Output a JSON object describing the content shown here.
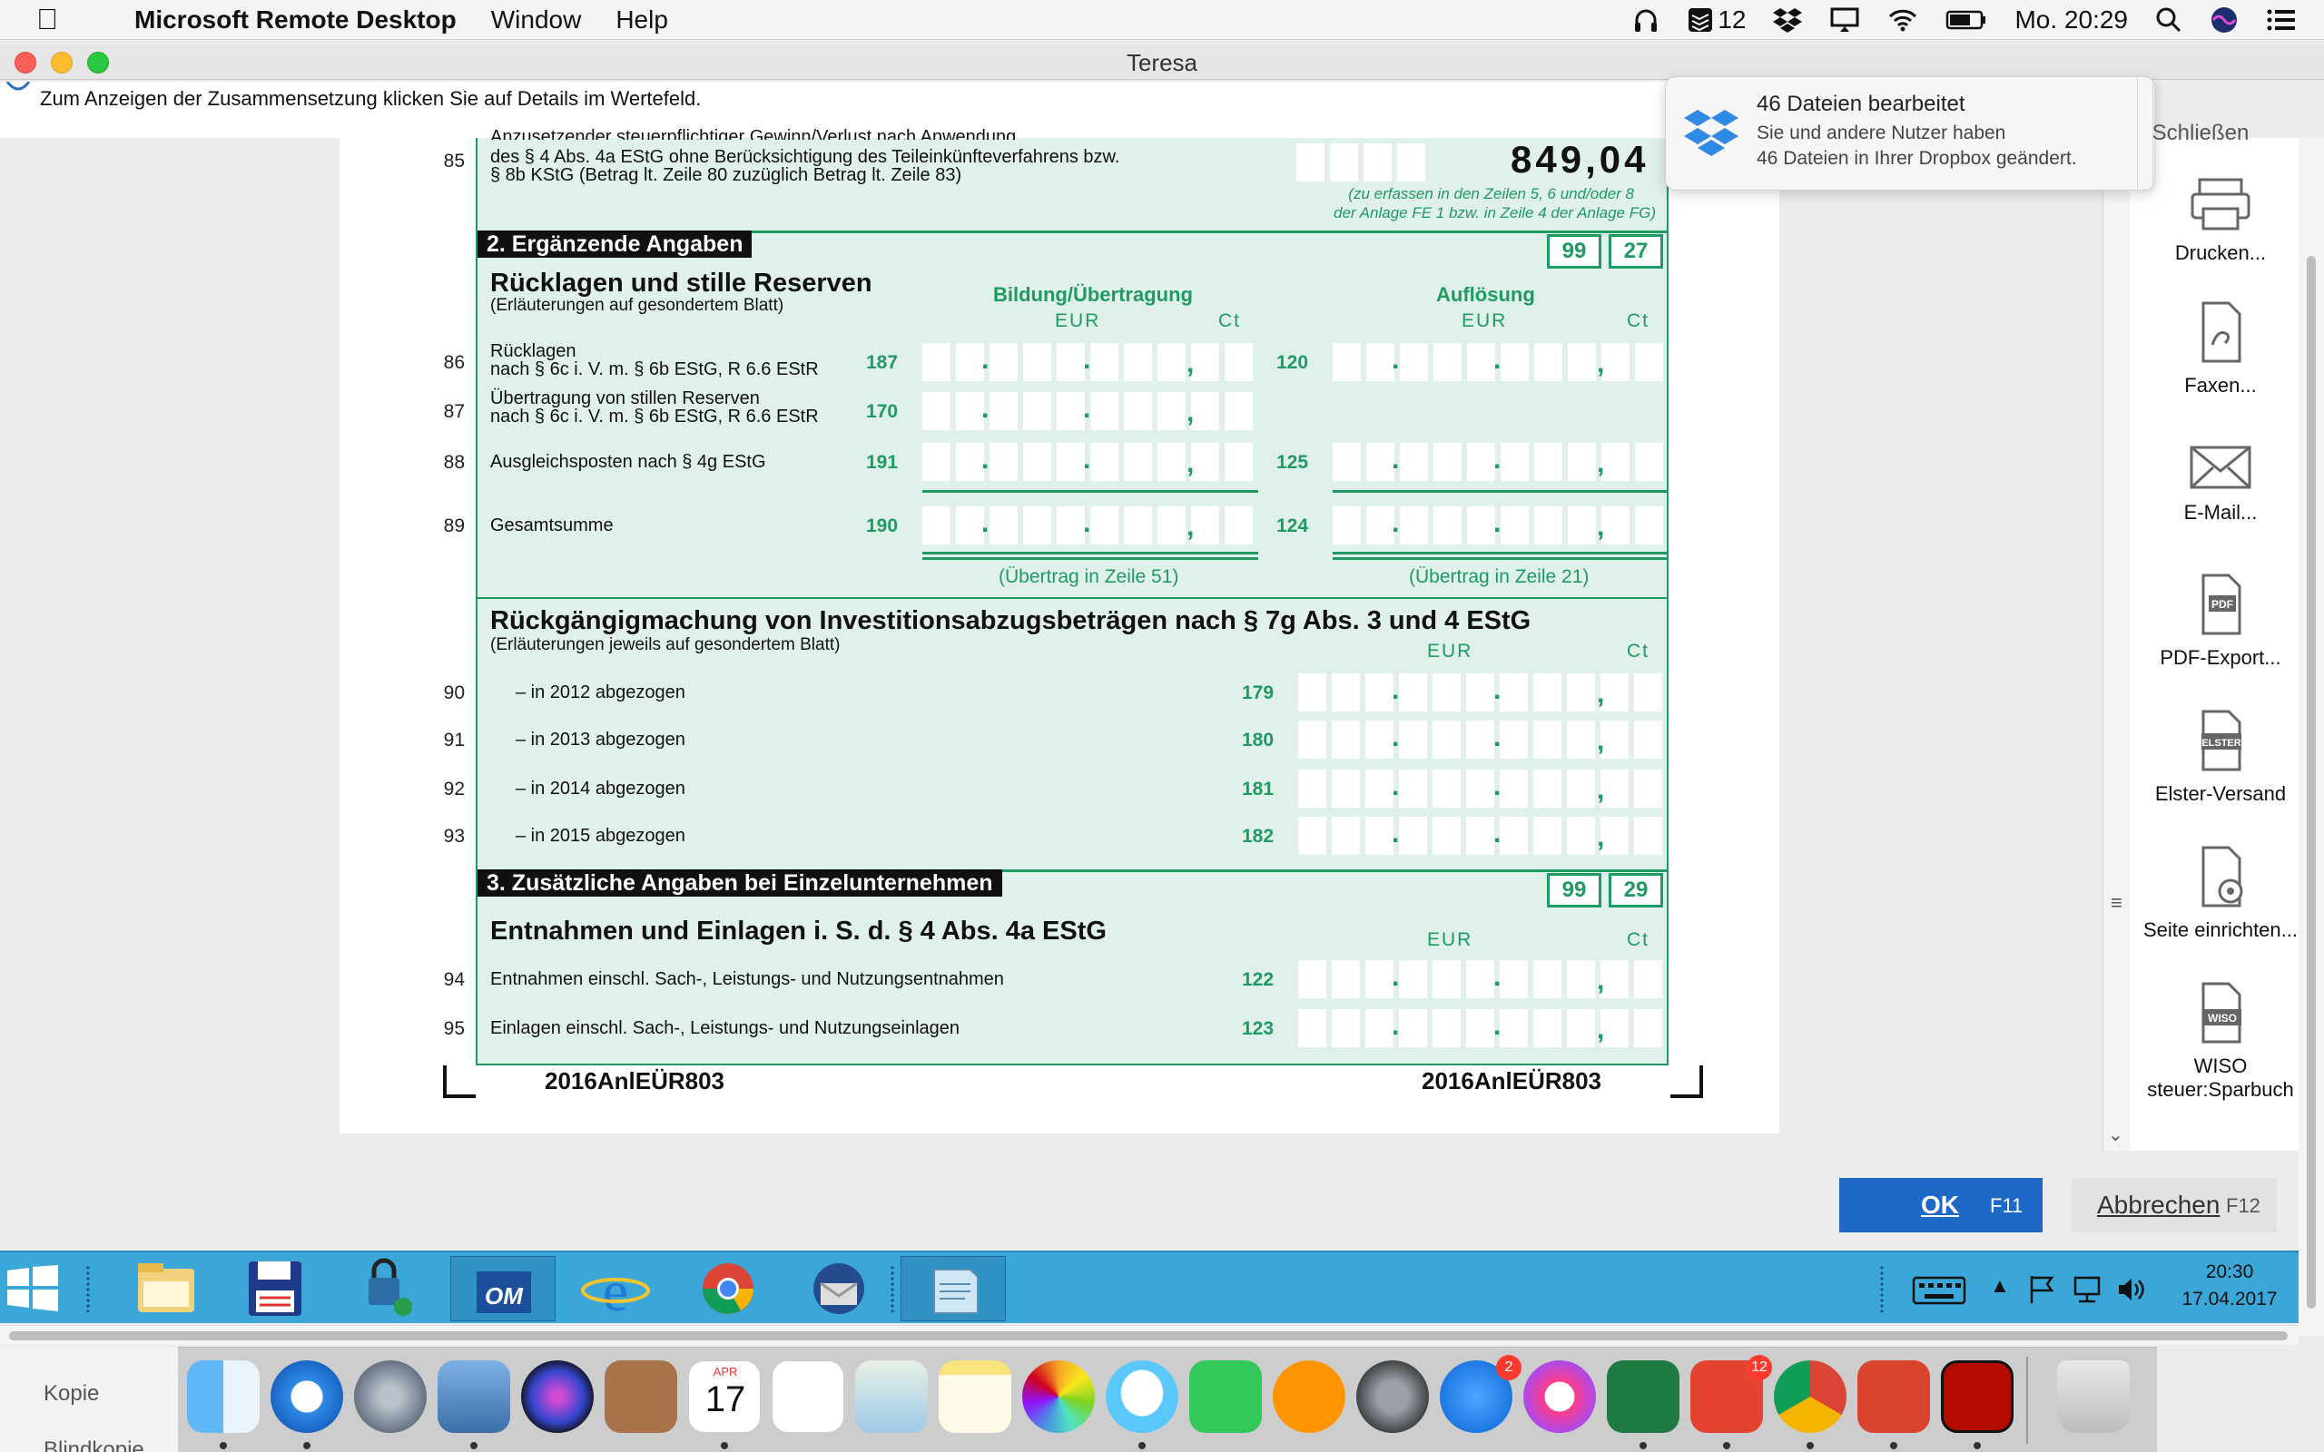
{
  "menubar": {
    "app_name": "Microsoft Remote Desktop",
    "menu_window": "Window",
    "menu_help": "Help",
    "notification_count": "12",
    "clock": "Mo. 20:29"
  },
  "window": {
    "title": "Teresa"
  },
  "info_hint": "Zum Anzeigen der Zusammensetzung klicken Sie auf Details im Wertefeld.",
  "form": {
    "row85": {
      "num": "85",
      "line1": "Anzusetzender steuerpflichtiger Gewinn/Verlust nach Anwendung",
      "line2": "des § 4 Abs. 4a EStG ohne Berücksichtigung des Teileinkünfteverfahrens bzw.",
      "line3": "§ 8b KStG (Betrag lt. Zeile 80 zuzüglich Betrag lt. Zeile 83)",
      "value": "849,04",
      "note1": "(zu erfassen in den Zeilen 5, 6 und/oder 8",
      "note2": "der Anlage FE 1 bzw. in Zeile 4 der Anlage FG)"
    },
    "section2": {
      "title": "2. Ergänzende Angaben",
      "box1": "99",
      "box2": "27"
    },
    "ruecklagen": {
      "title": "Rücklagen und stille Reserven",
      "subtitle": "(Erläuterungen auf gesondertem Blatt)",
      "col1": "Bildung/Übertragung",
      "col2": "Auflösung",
      "eur": "EUR",
      "ct": "Ct",
      "rows": [
        {
          "num": "86",
          "line1": "Rücklagen",
          "line2": "nach § 6c i. V. m. § 6b EStG, R 6.6 EStR",
          "code1": "187",
          "code2": "120"
        },
        {
          "num": "87",
          "line1": "Übertragung von stillen Reserven",
          "line2": "nach § 6c i. V. m. § 6b EStG, R 6.6 EStR",
          "code1": "170",
          "code2": ""
        },
        {
          "num": "88",
          "line1": "Ausgleichsposten nach § 4g EStG",
          "line2": "",
          "code1": "191",
          "code2": "125"
        },
        {
          "num": "89",
          "line1": "Gesamtsumme",
          "line2": "",
          "code1": "190",
          "code2": "124"
        }
      ],
      "transfer1": "(Übertrag in Zeile 51)",
      "transfer2": "(Übertrag in Zeile 21)"
    },
    "ruckgaengig": {
      "title": "Rückgängigmachung von Investitionsabzugsbeträgen nach § 7g Abs. 3 und 4 EStG",
      "subtitle": "(Erläuterungen jeweils auf gesondertem Blatt)",
      "eur": "EUR",
      "ct": "Ct",
      "rows": [
        {
          "num": "90",
          "label": "– in 2012 abgezogen",
          "code": "179"
        },
        {
          "num": "91",
          "label": "– in 2013 abgezogen",
          "code": "180"
        },
        {
          "num": "92",
          "label": "– in 2014 abgezogen",
          "code": "181"
        },
        {
          "num": "93",
          "label": "– in 2015 abgezogen",
          "code": "182"
        }
      ]
    },
    "section3": {
      "title": "3. Zusätzliche Angaben bei Einzelunternehmen",
      "box1": "99",
      "box2": "29"
    },
    "entnahmen": {
      "title": "Entnahmen und Einlagen i. S. d. § 4 Abs. 4a EStG",
      "eur": "EUR",
      "ct": "Ct",
      "rows": [
        {
          "num": "94",
          "label": "Entnahmen einschl. Sach-, Leistungs- und Nutzungsentnahmen",
          "code": "122"
        },
        {
          "num": "95",
          "label": "Einlagen einschl. Sach-, Leistungs- und Nutzungseinlagen",
          "code": "123"
        }
      ]
    },
    "footer_left": "2016AnlEÜR803",
    "footer_right": "2016AnlEÜR803"
  },
  "sidepanel": {
    "print": "Drucken...",
    "fax": "Faxen...",
    "email": "E-Mail...",
    "pdf": "PDF-Export...",
    "elster": "Elster-Versand",
    "page_setup": "Seite einrichten...",
    "wiso_line1": "WISO",
    "wiso_line2": "steuer:Sparbuch",
    "icon_pdf": "PDF",
    "icon_elster": "ELSTER",
    "icon_wiso": "WISO"
  },
  "dialog": {
    "ok": "OK",
    "ok_key": "F11",
    "cancel": "Abbrechen",
    "cancel_key": "F12"
  },
  "notification": {
    "title": "46 Dateien bearbeitet",
    "line1": "Sie und andere Nutzer haben",
    "line2": "46 Dateien in Ihrer Dropbox geändert.",
    "close": "Schließen"
  },
  "wintaskbar": {
    "time": "20:30",
    "date": "17.04.2017",
    "om_label": "OM"
  },
  "desktop": {
    "label1": "Kopie",
    "label2": "Blindkopie"
  },
  "dock": {
    "calendar_month": "APR",
    "calendar_day": "17",
    "appstore_badge": "2",
    "todoist_badge": "12"
  },
  "colors": {
    "form_green": "#1f9a63",
    "form_bg": "#dff1ea",
    "ok_blue": "#1e68c8",
    "taskbar": "#3aa7d8"
  }
}
